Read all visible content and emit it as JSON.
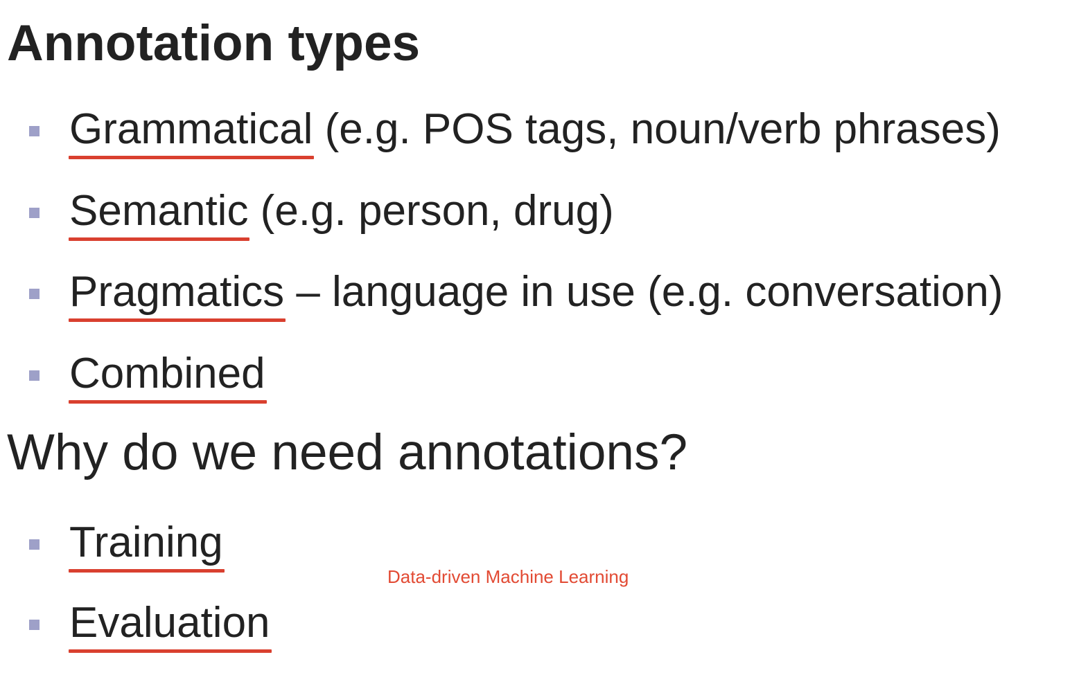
{
  "section1": {
    "heading": "Annotation types",
    "items": [
      {
        "term": "Grammatical",
        "rest": " (e.g. POS tags, noun/verb phrases)"
      },
      {
        "term": "Semantic",
        "rest": " (e.g. person, drug)"
      },
      {
        "term": "Pragmatics",
        "rest": " – language in use (e.g. conversation)"
      },
      {
        "term": "Combined",
        "rest": ""
      }
    ]
  },
  "section2": {
    "heading": "Why do we need annotations?",
    "items": [
      {
        "term": "Training",
        "rest": ""
      },
      {
        "term": "Evaluation",
        "rest": ""
      }
    ]
  },
  "footer_note": "Data-driven Machine Learning",
  "colors": {
    "text": "#222222",
    "bullet": "#9ea0c8",
    "underline": "#d9402f",
    "note": "#e24a33"
  }
}
